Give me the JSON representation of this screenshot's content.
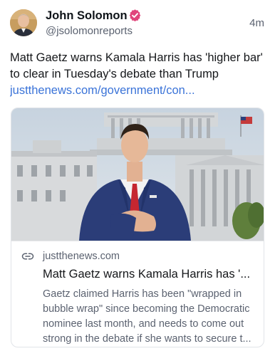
{
  "author": {
    "display_name": "John Solomon",
    "handle": "@jsolomonreports",
    "verified": true
  },
  "post": {
    "timestamp": "4m",
    "text": "Matt Gaetz warns Kamala Harris has 'higher bar' to clear in Tuesday's debate than Trump",
    "link_text": "justthenews.com/government/con..."
  },
  "link_card": {
    "domain": "justthenews.com",
    "title": "Matt Gaetz warns Kamala Harris has '...",
    "description": "Gaetz claimed Harris has been \"wrapped in bubble wrap\" since becoming the Democratic nominee last month, and needs to come out strong in the debate if she wants to secure t..."
  },
  "icons": {
    "verified": "verified-badge-icon",
    "link": "link-icon"
  },
  "colors": {
    "verified_badge": "#e0457b",
    "link": "#3a73d8",
    "secondary_text": "#5b6270"
  }
}
